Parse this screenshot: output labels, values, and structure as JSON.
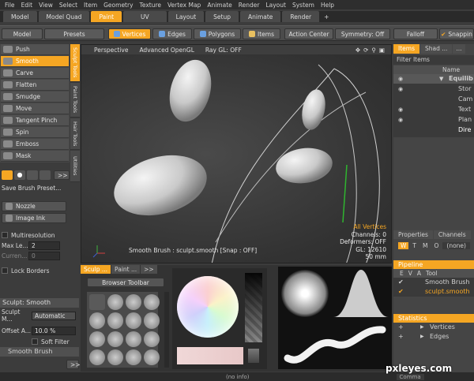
{
  "menu": [
    "File",
    "Edit",
    "View",
    "Select",
    "Item",
    "Geometry",
    "Texture",
    "Vertex Map",
    "Animate",
    "Render",
    "Layout",
    "System",
    "Help"
  ],
  "tabs": [
    "Model",
    "Model Quad",
    "Paint",
    "UV",
    "Layout",
    "Setup",
    "Animate",
    "Render",
    "+"
  ],
  "toolbar": {
    "model": "Model",
    "presets": "Presets",
    "vertices": "Vertices",
    "edges": "Edges",
    "polygons": "Polygons",
    "items": "Items",
    "action_center": "Action Center",
    "symmetry": "Symmetry: Off",
    "falloff": "Falloff",
    "snapping": "Snappin"
  },
  "tools": [
    "Push",
    "Smooth",
    "Carve",
    "Flatten",
    "Smudge",
    "Move",
    "Tangent Pinch",
    "Spin",
    "Emboss",
    "Mask"
  ],
  "vtabs": [
    "Sculpt Tools",
    "Paint Tools",
    "Hair Tools",
    "Utilities"
  ],
  "left_lower": {
    "save_preset": "Save Brush Preset...",
    "nozzle": "Nozzle",
    "image_ink": "Image Ink",
    "multiresolution": "Multiresolution",
    "max_level_label": "Max Le...",
    "max_level_value": "2",
    "current_label": "Curren...",
    "current_value": "0",
    "lock_borders": "Lock Borders",
    "sculpt_header": "Sculpt: Smooth",
    "sculpt_mode_label": "Sculpt M...",
    "sculpt_mode_value": "Automatic",
    "offset_label": "Offset A...",
    "offset_value": "10.0 %",
    "soft_filter": "Soft Filter",
    "smooth_brush": "Smooth Brush",
    "more": ">>"
  },
  "viewport": {
    "perspective": "Perspective",
    "gl": "Advanced OpenGL",
    "raygl": "Ray GL: OFF",
    "status": "Smooth Brush : sculpt.smooth  [Snap : OFF]",
    "stats": [
      "All Vertices",
      "Channels: 0",
      "Deformers: OFF",
      "GL: 12610",
      "50 mm"
    ]
  },
  "items_panel": {
    "tabs": [
      "Items",
      "Shad ...",
      "..."
    ],
    "filter": "Filter Items",
    "name_header": "Name",
    "rows": [
      "Equilib",
      "Stor",
      "Cam",
      "Text",
      "Plan",
      "Dire"
    ]
  },
  "properties": {
    "tabs": [
      "Properties",
      "Channels"
    ],
    "wtm": [
      "W",
      "T",
      "M",
      "O",
      "(none)"
    ],
    "pipeline": "Pipeline",
    "eva": [
      "E",
      "V",
      "A",
      "Tool"
    ],
    "pipe_rows": [
      "Smooth Brush",
      "sculpt.smooth"
    ],
    "statistics": "Statistics",
    "stat_rows": [
      "Vertices",
      "Edges"
    ]
  },
  "bottom": {
    "tabs": [
      "Sculp ...",
      "Paint ...",
      ">>"
    ],
    "browser": "Browser Toolbar"
  },
  "statusbar": {
    "info": "(no info)",
    "command": "Comma"
  },
  "watermark": "pxleyes.com"
}
